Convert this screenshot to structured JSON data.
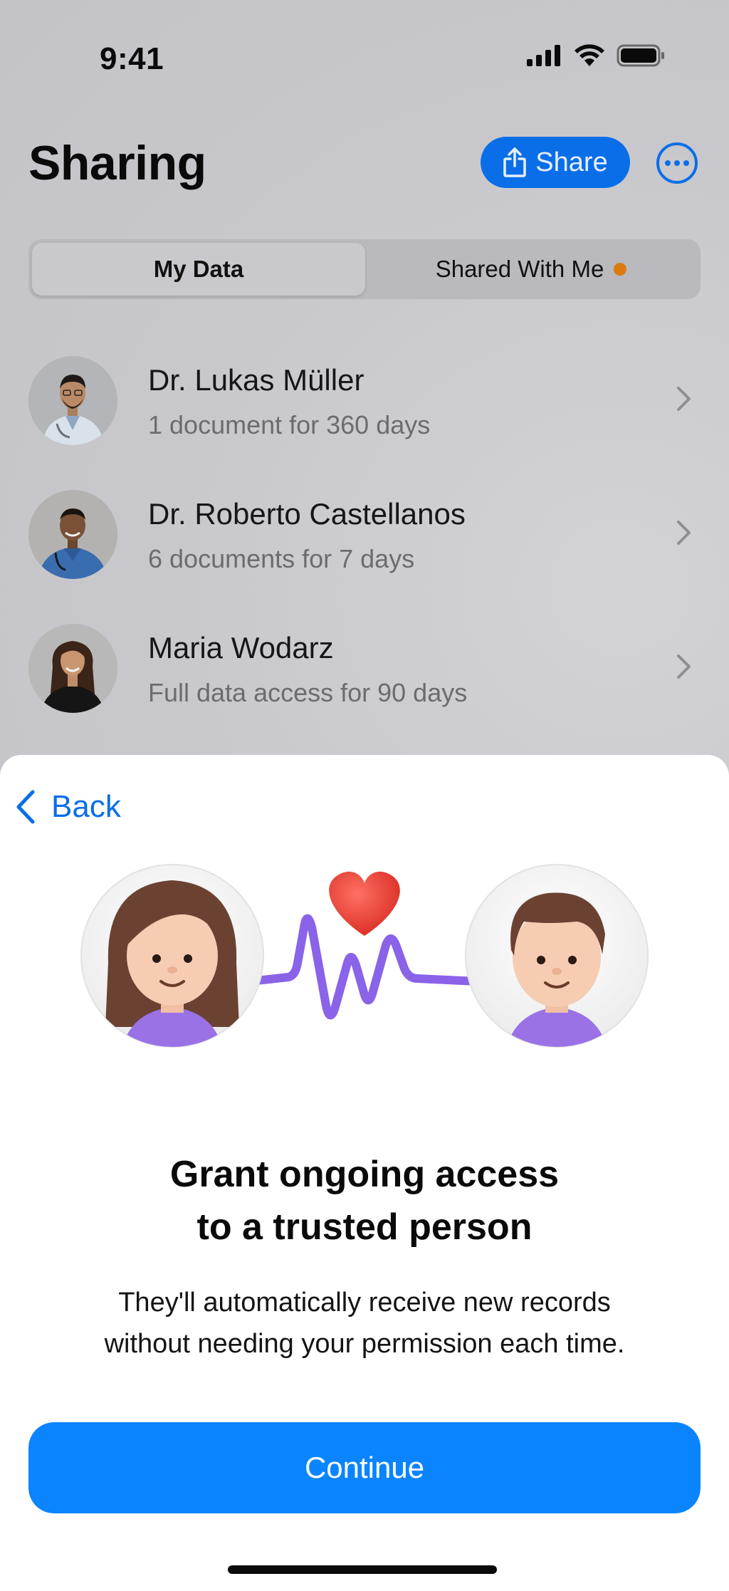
{
  "status_bar": {
    "time": "9:41",
    "icons": [
      "cellular-signal-icon",
      "wifi-icon",
      "battery-icon"
    ]
  },
  "header": {
    "title": "Sharing",
    "share_label": "Share",
    "share_icon": "share-icon",
    "more_icon": "more-icon"
  },
  "tabs": {
    "my_data": "My Data",
    "shared_with_me": "Shared With Me",
    "shared_with_me_has_notification": true
  },
  "shares": [
    {
      "name": "Dr. Lukas Müller",
      "detail": "1 document for 360 days"
    },
    {
      "name": "Dr. Roberto Castellanos",
      "detail": "6 documents for 7 days"
    },
    {
      "name": "Maria Wodarz",
      "detail": "Full data access for 90 days"
    }
  ],
  "sheet": {
    "back_label": "Back",
    "title_line1": "Grant ongoing access",
    "title_line2": "to a trusted person",
    "desc_line1": "They'll automatically receive new records",
    "desc_line2": "without needing your permission each time.",
    "continue_label": "Continue"
  },
  "colors": {
    "accent": "#0a84ff",
    "accent_dimmed": "#0a6ee8",
    "notification_dot": "#dd7a0e",
    "heart": "#e8403a",
    "heartbeat_line": "#8a63e8"
  }
}
